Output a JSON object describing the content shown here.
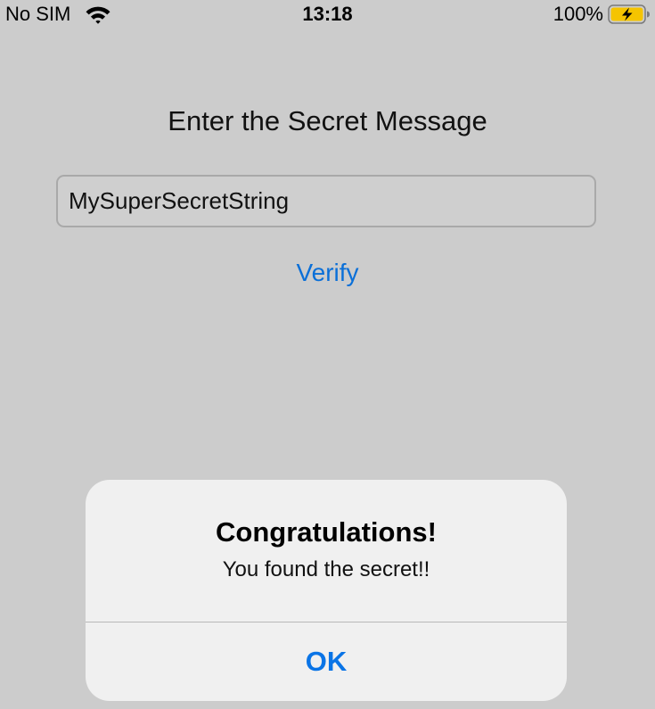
{
  "status_bar": {
    "carrier": "No SIM",
    "time": "13:18",
    "battery_percent": "100%",
    "wifi_icon": "wifi-icon",
    "battery_icon": "battery-charging-icon"
  },
  "main": {
    "prompt": "Enter the Secret Message",
    "input_value": "MySuperSecretString",
    "verify_label": "Verify"
  },
  "alert": {
    "title": "Congratulations!",
    "message": "You found the secret!!",
    "ok_label": "OK"
  },
  "colors": {
    "background": "#cccccc",
    "accent": "#0a74e6",
    "battery_fill": "#f5c400"
  }
}
